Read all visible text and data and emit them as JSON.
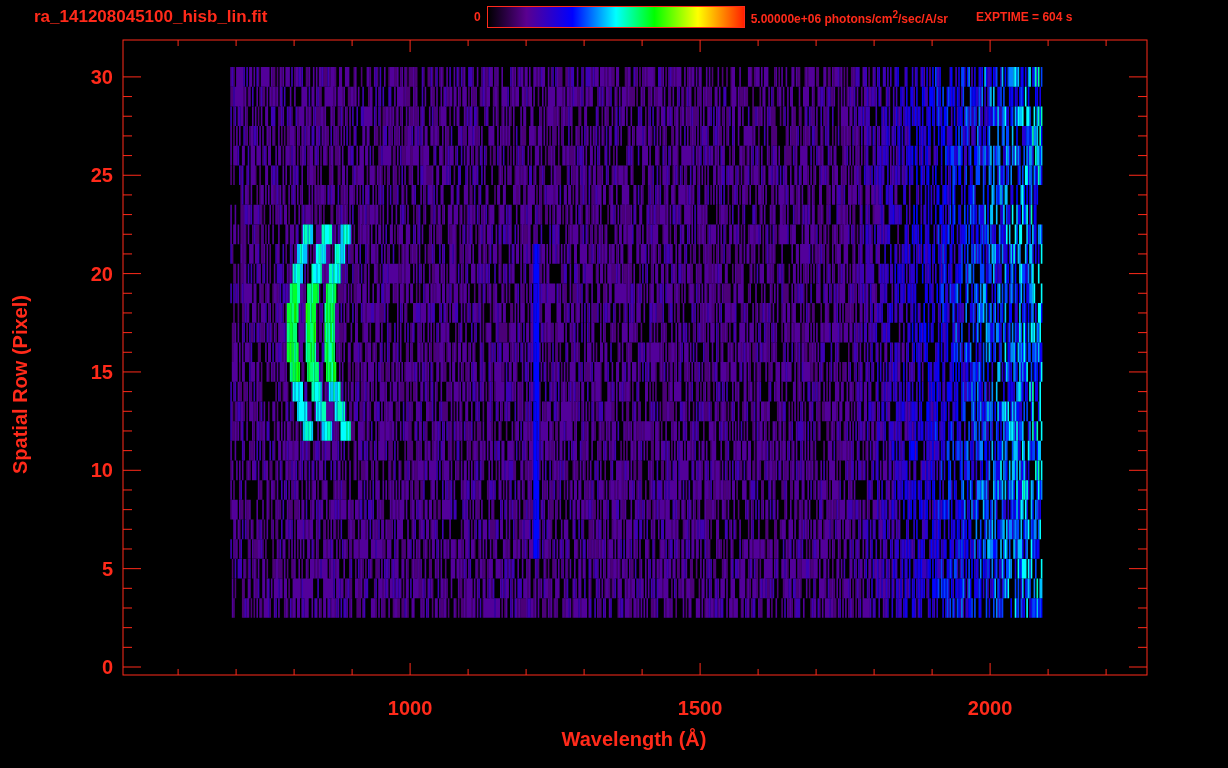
{
  "title": "ra_141208045100_hisb_lin.fit",
  "colorbar": {
    "min_label": "0",
    "max_label": "5.00000e+06 photons/cm$^{2}$/sec/A/sr"
  },
  "exposure": "EXPTIME = 604 s",
  "y_axis": {
    "label": "Spatial Row (Pixel)",
    "ticks": [
      "30",
      "25",
      "20",
      "15",
      "10",
      "5",
      "0"
    ]
  },
  "x_axis": {
    "label": "Wavelength (Å)",
    "ticks": [
      "1000",
      "1500",
      "2000"
    ]
  }
}
